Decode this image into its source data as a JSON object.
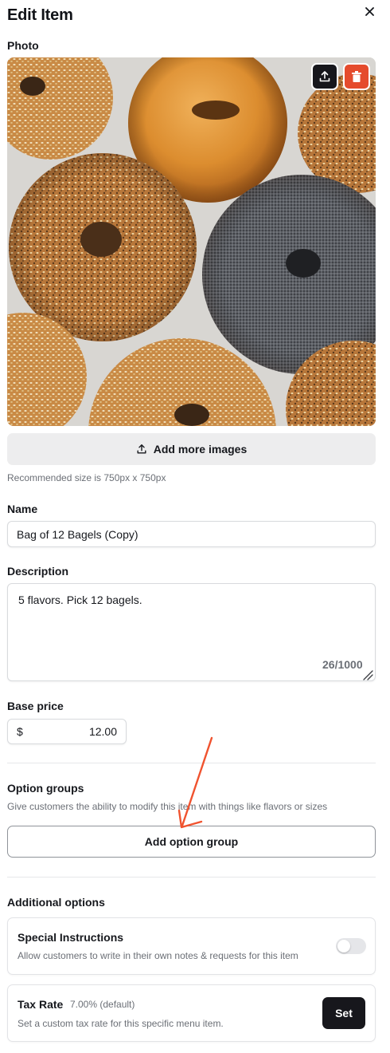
{
  "header": {
    "title": "Edit Item",
    "close_icon": "close-icon"
  },
  "photo": {
    "label": "Photo",
    "upload_icon": "upload-icon",
    "delete_icon": "trash-icon",
    "add_more_label": "Add more images",
    "recommended": "Recommended size is 750px x 750px"
  },
  "name": {
    "label": "Name",
    "value": "Bag of 12 Bagels (Copy)"
  },
  "description": {
    "label": "Description",
    "value": "5 flavors. Pick 12 bagels.",
    "counter": "26/1000"
  },
  "base_price": {
    "label": "Base price",
    "currency": "$",
    "value": "12.00"
  },
  "option_groups": {
    "label": "Option groups",
    "description": "Give customers the ability to modify this item with things like flavors or sizes",
    "add_button": "Add option group"
  },
  "additional_options": {
    "label": "Additional options",
    "special_instructions": {
      "title": "Special Instructions",
      "description": "Allow customers to write in their own notes & requests for this item",
      "enabled": false
    },
    "tax_rate": {
      "title": "Tax Rate",
      "value": "7.00% (default)",
      "description": "Set a custom tax rate for this specific menu item.",
      "button": "Set"
    }
  },
  "colors": {
    "accent_dark": "#17171c",
    "danger": "#e54b2d",
    "annotation_arrow": "#f0532f"
  }
}
